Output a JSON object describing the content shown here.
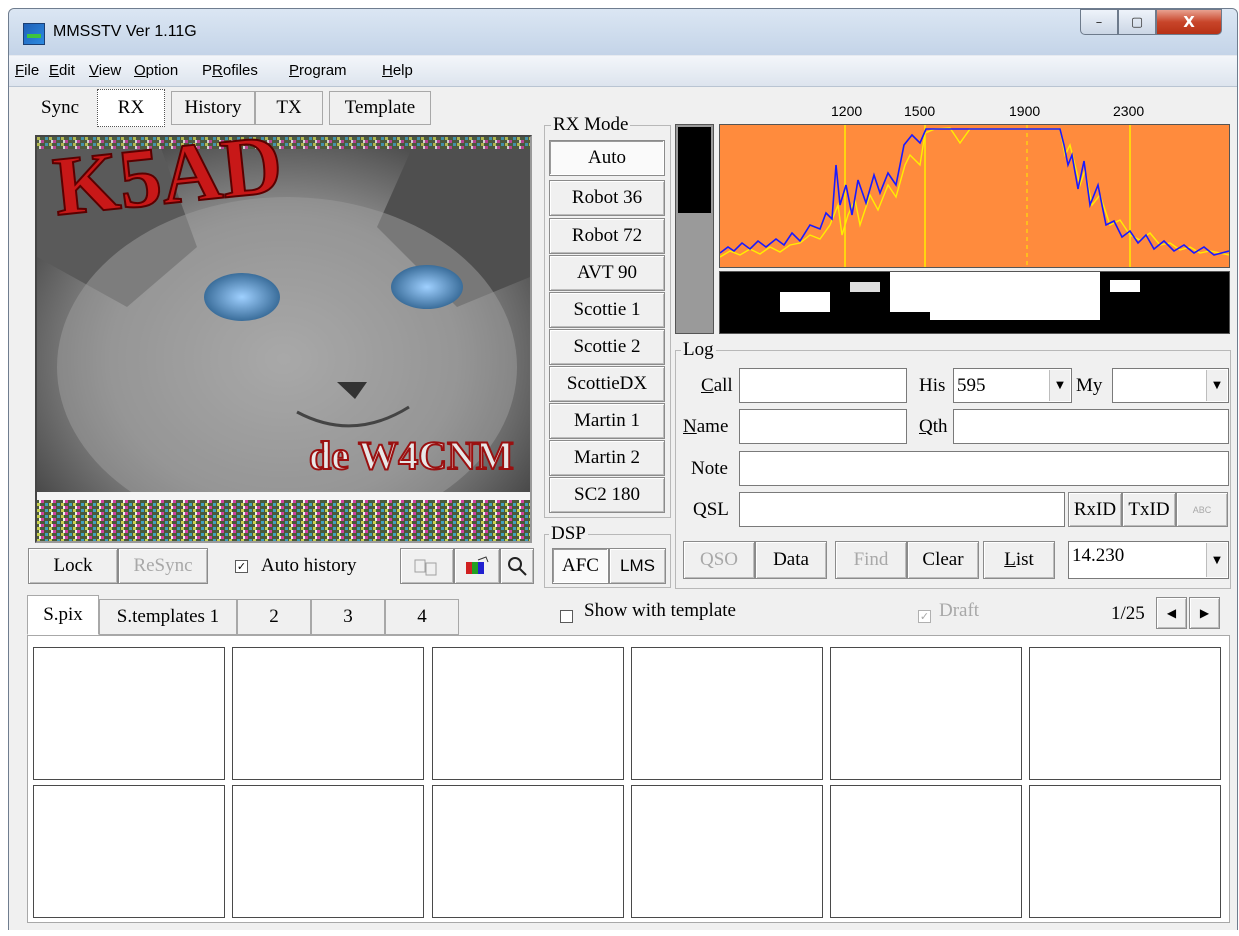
{
  "window": {
    "title": "MMSSTV Ver 1.11G",
    "min_glyph": "–",
    "max_glyph": "▢",
    "close_glyph": "X"
  },
  "menu": [
    {
      "u": "F",
      "rest": "ile"
    },
    {
      "u": "E",
      "rest": "dit"
    },
    {
      "u": "V",
      "rest": "iew"
    },
    {
      "u": "O",
      "rest": "ption"
    },
    {
      "pre": "P",
      "u": "R",
      "rest": "ofiles"
    },
    {
      "u": "P",
      "rest": "rogram"
    },
    {
      "u": "H",
      "rest": "elp"
    }
  ],
  "top_tabs": [
    "Sync",
    "RX",
    "History",
    "TX",
    "Template"
  ],
  "rx_image": {
    "text_top": "K5AD",
    "text_bottom": "de W4CNM"
  },
  "rx_controls": {
    "lock": "Lock",
    "resync": "ReSync",
    "auto_history": "Auto history",
    "auto_history_checked": true
  },
  "rx_mode": {
    "label": "RX Mode",
    "modes": [
      "Auto",
      "Robot 36",
      "Robot 72",
      "AVT 90",
      "Scottie 1",
      "Scottie 2",
      "ScottieDX",
      "Martin 1",
      "Martin 2",
      "SC2 180"
    ],
    "selected": "Auto"
  },
  "dsp": {
    "label": "DSP",
    "afc": "AFC",
    "lms": "LMS"
  },
  "spectrum": {
    "freq_labels": [
      "1200",
      "1500",
      "1900",
      "2300"
    ],
    "bg_color": "#ff8b3d",
    "trace_color": "#1a1aff",
    "peak_color": "#ffee00"
  },
  "log": {
    "label": "Log",
    "call_label_u": "C",
    "call_label_rest": "all",
    "call_value": "",
    "his_label": "His",
    "his_value": "595",
    "my_label": "My",
    "my_value": "",
    "name_label_u": "N",
    "name_label_rest": "ame",
    "name_value": "",
    "qth_label_u": "Q",
    "qth_label_rest": "th",
    "qth_value": "",
    "note_label": "Note",
    "note_value": "",
    "qsl_label": "QSL",
    "qsl_value": "",
    "rxid": "RxID",
    "txid": "TxID",
    "abc": "ABC",
    "qso": "QSO",
    "data": "Data",
    "find": "Find",
    "clear": "Clear",
    "list_u": "L",
    "list_rest": "ist",
    "freq": "14.230"
  },
  "bottom_tabs": [
    "S.pix",
    "S.templates 1",
    "2",
    "3",
    "4"
  ],
  "show_with_template": {
    "label": "Show with template",
    "checked": false
  },
  "draft": {
    "label": "Draft",
    "checked": true
  },
  "pager": {
    "text": "1/25",
    "prev": "◀",
    "next": "▶"
  }
}
